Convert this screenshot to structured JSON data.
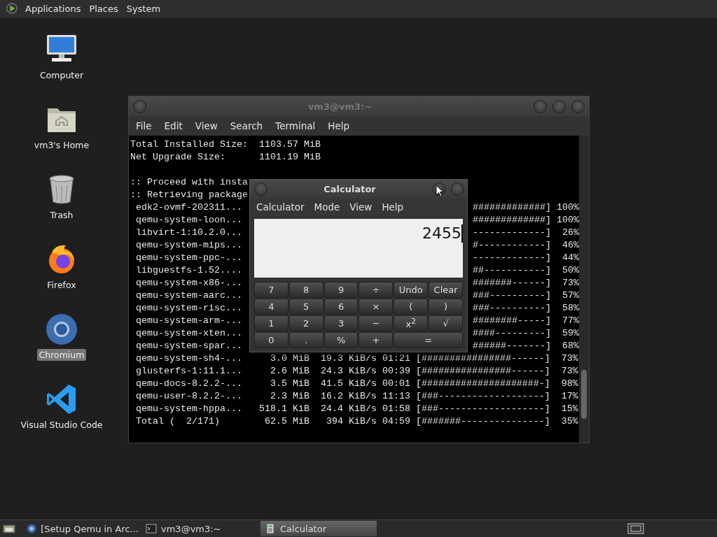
{
  "top_panel": {
    "menus": [
      "Applications",
      "Places",
      "System"
    ]
  },
  "desktop_icons": [
    {
      "label": "Computer",
      "kind": "computer",
      "selected": false
    },
    {
      "label": "vm3's Home",
      "kind": "home",
      "selected": false
    },
    {
      "label": "Trash",
      "kind": "trash",
      "selected": false
    },
    {
      "label": "Firefox",
      "kind": "firefox",
      "selected": false
    },
    {
      "label": "Chromium",
      "kind": "chromium",
      "selected": true
    },
    {
      "label": "Visual Studio Code",
      "kind": "code",
      "selected": false
    }
  ],
  "terminal": {
    "title": "vm3@vm3:~",
    "menu": [
      "File",
      "Edit",
      "View",
      "Search",
      "Terminal",
      "Help"
    ],
    "lines": [
      {
        "text": "Total Installed Size:  1103.57 MiB"
      },
      {
        "text": "Net Upgrade Size:      1101.19 MiB"
      },
      {
        "text": ":: Proceed with insta",
        "blank_before": true
      },
      {
        "text": ":: Retrieving package"
      },
      {
        "text": " edk2-ovmf-202311...",
        "right": "#############] 100%"
      },
      {
        "text": " qemu-system-loon...",
        "right": "#############] 100%"
      },
      {
        "text": " libvirt-1:10.2.0...",
        "right": "-------------]  26%"
      },
      {
        "text": " qemu-system-mips...",
        "right": "#------------]  46%"
      },
      {
        "text": " qemu-system-ppc-...",
        "right": "-------------]  44%"
      },
      {
        "text": " libguestfs-1.52....",
        "right": "##-----------]  50%"
      },
      {
        "text": " qemu-system-x86-...",
        "right": "#######------]  73%"
      },
      {
        "text": " qemu-system-aarc...",
        "right": "###----------]  57%"
      },
      {
        "text": " qemu-system-risc...",
        "right": "###----------]  58%"
      },
      {
        "text": " qemu-system-arm-...",
        "right": "########-----]  77%"
      },
      {
        "text": " qemu-system-xten...",
        "right": "####---------]  59%"
      },
      {
        "text": " qemu-system-spar...",
        "right": "######-------]  68%"
      },
      {
        "text": " qemu-system-sh4-...     3.0 MiB  19.3 KiB/s 01:21 [################------]  73%"
      },
      {
        "text": " glusterfs-1:11.1...     2.6 MiB  24.3 KiB/s 00:39 [################------]  73%"
      },
      {
        "text": " qemu-docs-8.2.2-...     3.5 MiB  41.5 KiB/s 00:01 [#####################-]  98%"
      },
      {
        "text": " qemu-user-8.2.2-...     2.3 MiB  16.2 KiB/s 11:13 [###-------------------]  17%"
      },
      {
        "text": " qemu-system-hppa...   518.1 KiB  24.4 KiB/s 01:58 [###-------------------]  15%"
      },
      {
        "text": " Total (  2/171)        62.5 MiB   394 KiB/s 04:59 [#######---------------]  35%"
      }
    ]
  },
  "calculator": {
    "title": "Calculator",
    "menu": [
      "Calculator",
      "Mode",
      "View",
      "Help"
    ],
    "display": "2455",
    "keys": [
      {
        "label": "7"
      },
      {
        "label": "8"
      },
      {
        "label": "9"
      },
      {
        "label": "÷"
      },
      {
        "label": "Undo"
      },
      {
        "label": "Clear"
      },
      {
        "label": "4"
      },
      {
        "label": "5"
      },
      {
        "label": "6"
      },
      {
        "label": "×"
      },
      {
        "label": "("
      },
      {
        "label": ")"
      },
      {
        "label": "1"
      },
      {
        "label": "2"
      },
      {
        "label": "3"
      },
      {
        "label": "−"
      },
      {
        "label": "x$^{2}$"
      },
      {
        "label": "√"
      },
      {
        "label": "0"
      },
      {
        "label": "."
      },
      {
        "label": "%"
      },
      {
        "label": "+"
      },
      {
        "label": "=",
        "wide": true
      }
    ]
  },
  "taskbar": {
    "tasks": [
      {
        "label": "[Setup Qemu in Arc...",
        "kind": "browser",
        "selected": false
      },
      {
        "label": "vm3@vm3:~",
        "kind": "terminal",
        "selected": false
      },
      {
        "label": "Calculator",
        "kind": "calculator",
        "selected": true
      }
    ]
  }
}
